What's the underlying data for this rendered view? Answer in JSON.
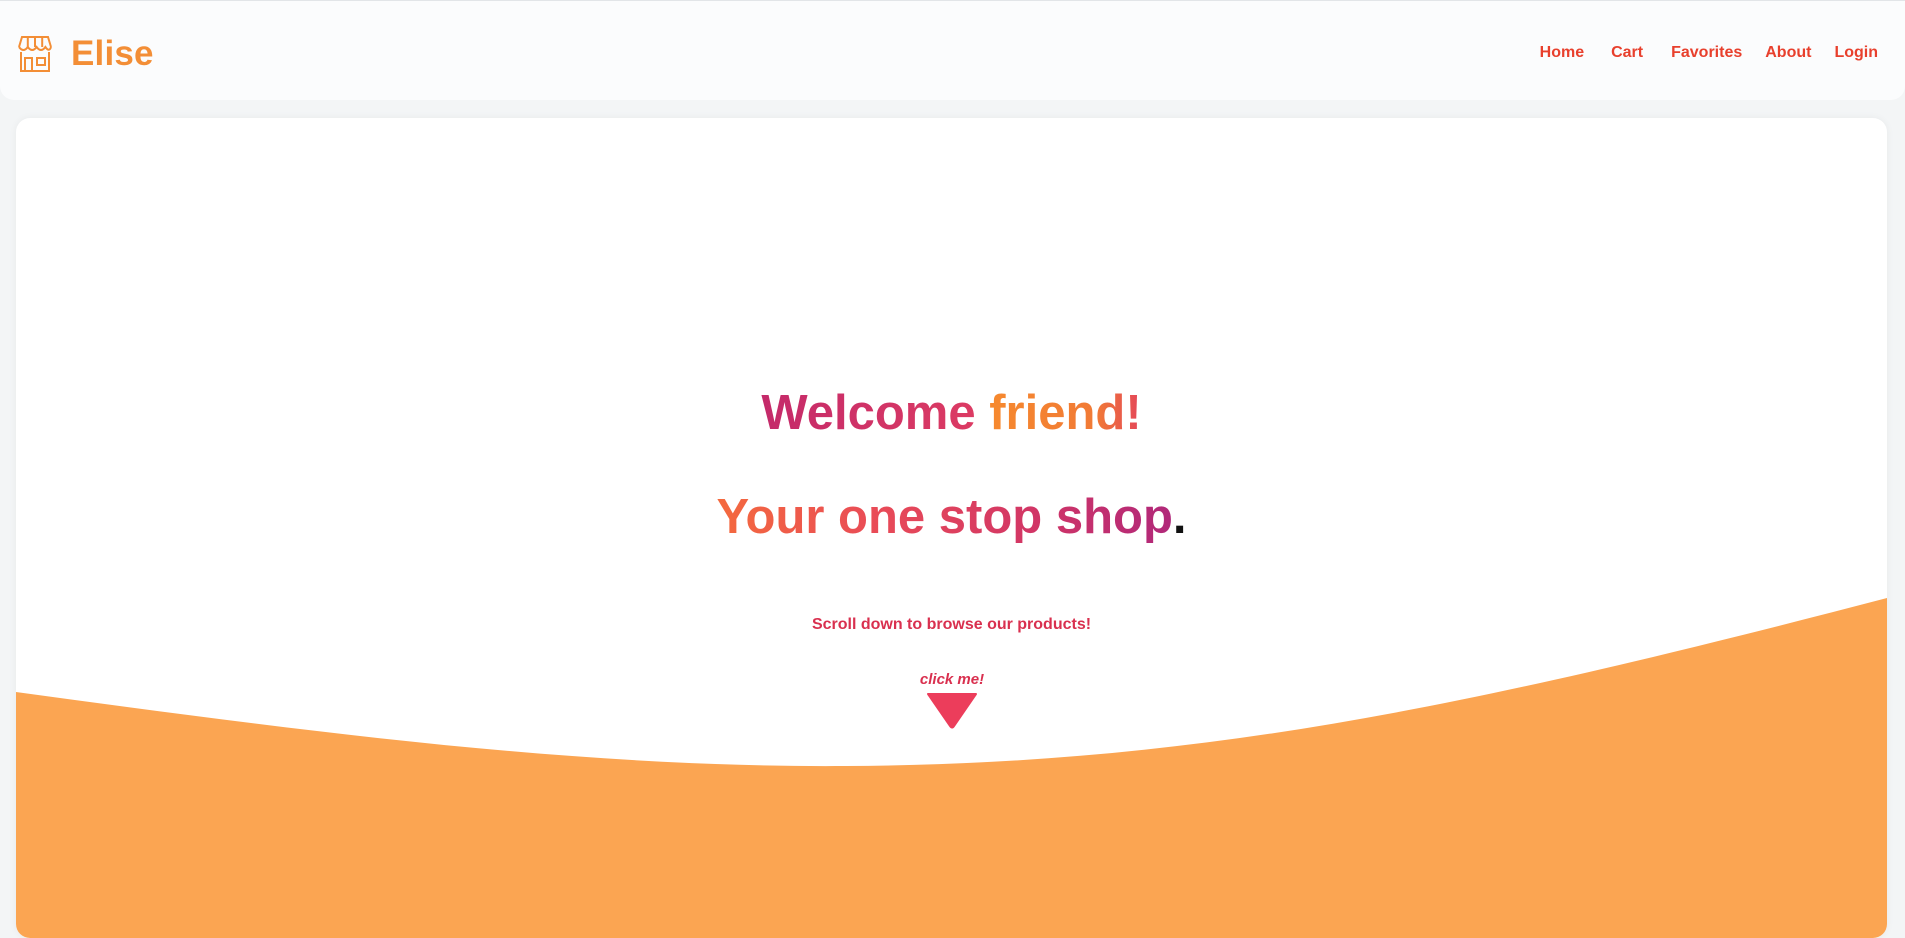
{
  "navbar": {
    "brand": {
      "icon": "storefront-icon",
      "name": "Elise"
    },
    "links": [
      {
        "label": "Home"
      },
      {
        "label": "Cart"
      },
      {
        "label": "Favorites"
      },
      {
        "label": "About"
      },
      {
        "label": "Login"
      }
    ]
  },
  "hero": {
    "welcome_part1": "Welcome",
    "welcome_part2": "friend!",
    "tagline_part1": "Your one stop shop",
    "tagline_part2": ".",
    "scroll_hint": "Scroll down to browse our products!",
    "cta": {
      "label": "click me!",
      "icon": "triangle-down-icon"
    }
  },
  "colors": {
    "brand_orange": "#f38e36",
    "nav_red": "#e8402d",
    "accent_pink": "#d9304f",
    "wave_orange": "#fba552",
    "page_bg": "#f3f5f6"
  }
}
